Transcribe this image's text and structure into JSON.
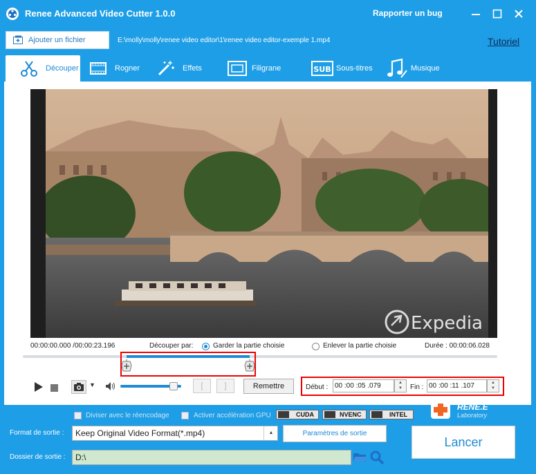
{
  "app": {
    "title": "Renee Advanced Video Cutter 1.0.0",
    "bug_link": "Rapporter un bug"
  },
  "filebar": {
    "add_file": "Ajouter un fichier",
    "path": "E:\\molly\\molly\\renee video editor\\1\\renee video editor-exemple 1.mp4",
    "tutorial": "Tutoriel"
  },
  "tabs": [
    {
      "label": "Découper",
      "icon": "scissors-icon",
      "active": true
    },
    {
      "label": "Rogner",
      "icon": "crop-icon",
      "active": false
    },
    {
      "label": "Effets",
      "icon": "magic-wand-icon",
      "active": false
    },
    {
      "label": "Filigrane",
      "icon": "watermark-icon",
      "active": false
    },
    {
      "label": "Sous-titres",
      "icon": "subtitle-icon",
      "active": false
    },
    {
      "label": "Musique",
      "icon": "music-icon",
      "active": false
    }
  ],
  "player": {
    "watermark": "Expedia",
    "current_time": "00:00:00.000",
    "total_time": "/00:00:23.196",
    "cut_by": "Découper par:",
    "keep_option": "Garder la partie choisie",
    "remove_option": "Enlever la partie choisie",
    "duration": "Durée : 00:00:06.028",
    "selection_start_fraction": 0.218,
    "selection_end_fraction": 0.478,
    "volume_fraction": 0.88
  },
  "controls": {
    "mark_in": "[",
    "mark_out": "]",
    "reset": "Remettre",
    "start_label": "Début :",
    "start_value": "00 :00 :05 .079",
    "end_label": "Fin :",
    "end_value": "00 :00 :11 .107"
  },
  "options": {
    "split_label": "Diviser avec le réencodage",
    "gpu_label": "Activer accélération GPU",
    "gpu_badges": [
      "CUDA",
      "NVENC",
      "INTEL"
    ]
  },
  "brand": {
    "name": "RENE.E",
    "sub": "Laboratory"
  },
  "output": {
    "format_label": "Format de sortie :",
    "format_value": "Keep Original Video Format(*.mp4)",
    "params_button": "Paramètres de sortie",
    "folder_label": "Dossier de sortie :",
    "folder_value": "D:\\",
    "launch": "Lancer"
  },
  "colors": {
    "accent": "#1e9ee6",
    "highlight_box": "#ee0000",
    "folder_bg": "#cfe8cf"
  }
}
